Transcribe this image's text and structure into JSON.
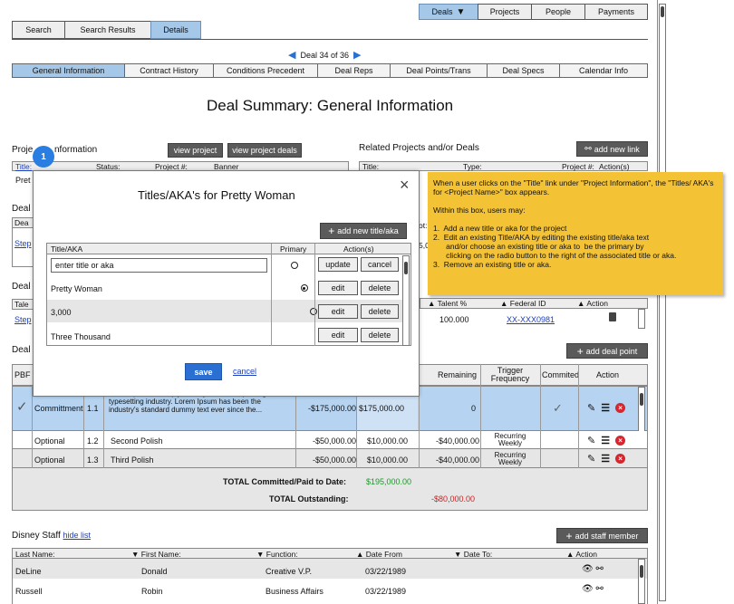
{
  "top_nav": [
    {
      "label": "Deals",
      "active": true
    },
    {
      "label": "Projects"
    },
    {
      "label": "People"
    },
    {
      "label": "Payments"
    }
  ],
  "left_tabs": [
    {
      "label": "Search"
    },
    {
      "label": "Search Results"
    },
    {
      "label": "Details",
      "active": true
    }
  ],
  "pager": {
    "label": "Deal 34 of 36"
  },
  "section_tabs": [
    {
      "label": "General Information",
      "active": true
    },
    {
      "label": "Contract History"
    },
    {
      "label": "Conditions Precedent"
    },
    {
      "label": "Deal Reps"
    },
    {
      "label": "Deal Points/Trans"
    },
    {
      "label": "Deal Specs"
    },
    {
      "label": "Calendar Info"
    }
  ],
  "page_title": "Deal Summary:  General Information",
  "project_info": {
    "heading_left": "Proje",
    "heading_right": "nformation",
    "view_project": "view project",
    "view_project_deals": "view project deals",
    "col_title": "Title:",
    "col_status": "Status:",
    "col_project": "Project #:",
    "col_banner": "Banner",
    "row_title_partial": "Pret"
  },
  "related": {
    "heading": "Related Projects and/or Deals",
    "add_new_link": "add new link",
    "col_title": "Title:",
    "col_type": "Type:",
    "col_project": "Project #:",
    "col_actions": "Action(s)"
  },
  "left_partials": {
    "deal_a": "Deal",
    "dea": "Dea",
    "step_a": "Step",
    "deal_b": "Deal",
    "tale": "Tale",
    "step_b": "Step",
    "deal_c": "Deal",
    "pbf": "PBF"
  },
  "talent_partial": {
    "talent_pct_hdr": "Talent %",
    "federal_id_hdr": "Federal ID",
    "action_hdr": "Action",
    "talent_pct": "100.000",
    "federal_id": "XX-XXX0981",
    "id_fragment_1": "ot:",
    "id_fragment_2": "5,0"
  },
  "deal_points": {
    "add_deal_point": "add deal point",
    "headers": {
      "remaining": "Remaining",
      "trigger": "Trigger Frequency",
      "committed": "Commited",
      "action": "Action"
    },
    "rows": [
      {
        "type": "Committment",
        "num": "1.1",
        "desc": "Lorem Ipsum is simply dummy text of the printing and typesetting industry. Lorem Ipsum has been the industry's standard dummy text ever since the...",
        "amount": "-$175,000.00",
        "paid": "$175,000.00",
        "remaining": "0",
        "trigger": "",
        "committed": true
      },
      {
        "type": "Optional",
        "num": "1.2",
        "desc": "Second Polish",
        "amount": "-$50,000.00",
        "paid": "$10,000.00",
        "remaining": "-$40,000.00",
        "trigger": "Recurring Weekly",
        "committed": false
      },
      {
        "type": "Optional",
        "num": "1.3",
        "desc": "Third Polish",
        "amount": "-$50,000.00",
        "paid": "$10,000.00",
        "remaining": "-$40,000.00",
        "trigger": "Recurring Weekly",
        "committed": false
      }
    ],
    "total_committed_label": "TOTAL Committed/Paid to Date:",
    "total_committed_value": "$195,000.00",
    "total_outstanding_label": "TOTAL Outstanding:",
    "total_outstanding_value": "-$80,000.00",
    "colors": {
      "green": "#1a9a2a",
      "red": "#d02020"
    }
  },
  "staff": {
    "heading": "Disney Staff",
    "hide_list": "hide list",
    "add_staff_member": "add staff member",
    "headers": {
      "last": "Last Name:",
      "first": "First Name:",
      "function": "Function:",
      "date_from": "Date From",
      "date_to": "Date To:",
      "action": "Action"
    },
    "rows": [
      {
        "last": "DeLine",
        "first": "Donald",
        "function": "Creative V.P.",
        "date_from": "03/22/1989"
      },
      {
        "last": "Russell",
        "first": "Robin",
        "function": "Business Affairs",
        "date_from": "03/22/1989"
      }
    ]
  },
  "modal": {
    "badge": "1",
    "title": "Titles/AKA's for Pretty Woman",
    "close": "×",
    "add_new": "add new title/aka",
    "col_title": "Title/AKA",
    "col_primary": "Primary",
    "col_actions": "Action(s)",
    "input_value": "enter title or aka",
    "update": "update",
    "cancel": "cancel",
    "edit": "edit",
    "delete": "delete",
    "rows": [
      {
        "title": "Pretty Woman",
        "primary": true
      },
      {
        "title": "3,000",
        "primary": false
      },
      {
        "title": "Three Thousand",
        "primary": false
      }
    ],
    "save": "save",
    "cancel_link": "cancel"
  },
  "note": {
    "intro": "When a user clicks on the \"Title\" link under \"Project Information\", the \"Titles/ AKA's for <Project Name>\" box appears.",
    "within": "Within this box, users may:",
    "items": [
      "1.  Add a new title or aka for the project",
      "2.  Edit an existing Title/AKA by editing the existing title/aka text",
      "      and/or choose an existing title or aka to  be the primary by",
      "      clicking on the radio button to the right of the associated title or aka.",
      "3.  Remove an existing title or aka."
    ]
  },
  "colors": {
    "active_tab": "#a6c8e8",
    "save_button": "#2a6fd1",
    "note": "#f4c235",
    "badge": "#2a7de1"
  }
}
